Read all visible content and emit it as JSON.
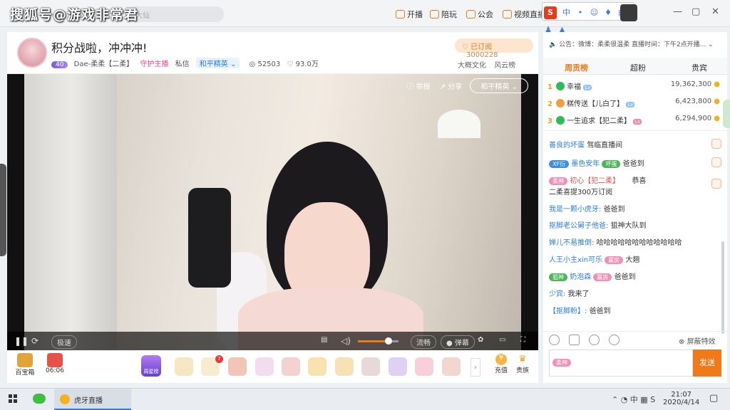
{
  "app": {
    "taskbar_label": "虎牙直播"
  },
  "watermark": "搜狐号@游戏非常君",
  "search": {
    "placeholder": "大仙"
  },
  "topnav": [
    {
      "label": "开播"
    },
    {
      "label": "陪玩"
    },
    {
      "label": "公会"
    },
    {
      "label": "视频直播"
    }
  ],
  "room": {
    "title": "积分战啦，冲冲冲!",
    "level": "40",
    "streamer": "Dae-柔柔【二柔】",
    "guard_tag": "守护主播",
    "message_link": "私信",
    "category": "和平精英",
    "viewers": "52503",
    "fans_count": "93.0万",
    "subscribe_label": "已订阅",
    "subscribe_count": "3000228",
    "links": [
      "大概文化",
      "风云榜"
    ]
  },
  "video": {
    "report": "举报",
    "share": "分享",
    "quality_top": "和平精英",
    "speed": "极速",
    "quality_bottom": "流畅",
    "danmu": "弹幕",
    "volume_level": 0.75
  },
  "gifts": {
    "treasure_label": "百宝箱",
    "timer_label": "06:06",
    "recharge_label": "充值",
    "noble_label": "贵族",
    "weekly_star": "周星榜",
    "badge_count": "7"
  },
  "panel": {
    "notice": "公告：微博：柔柔很温柔  直播时间：下午2点开播...",
    "tabs": [
      "周贡榜",
      "超粉",
      "贵宾"
    ],
    "ranking": [
      {
        "rank": "1",
        "name": "幸福",
        "lv": "Lv",
        "value": "19,362,300"
      },
      {
        "rank": "2",
        "name": "糕传送【儿白了】",
        "lv": "Lv",
        "value": "6,423,800"
      },
      {
        "rank": "3",
        "name": "一生追求【犯二柔】",
        "lv": "Lv",
        "value": "6,294,900"
      }
    ],
    "chat": [
      {
        "user": "善良的坏蛋",
        "text": "驾临直播间"
      },
      {
        "badge": "XF衍",
        "user": "墨色安年",
        "fan": "坏蛋",
        "text": "爸爸到"
      },
      {
        "fan": "柔神",
        "user": "初心【犯二柔】",
        "text": "恭喜"
      },
      {
        "text": "二柔喜提300万订阅"
      },
      {
        "user": "我是一颗小虎牙:",
        "text": "爸爸到"
      },
      {
        "user": "抠脚老公舅子他爸:",
        "text": "狙神大队到"
      },
      {
        "user": "婵儿不易推倒:",
        "text": "哈哈哈哈哈哈哈哈哈哈哈哈"
      },
      {
        "user": "人王小主xin可乐",
        "fan": "赢房",
        "text": "大翘"
      },
      {
        "badge": "狙神",
        "user": "奶泡森",
        "fan": "赢房",
        "text": "爸爸到"
      },
      {
        "user": "少宾:",
        "text": "我来了"
      },
      {
        "user": "【抠脚粉】:",
        "text": "爸爸到"
      }
    ],
    "shield_label": "屏蔽特效",
    "input_badge": "柔神",
    "send_label": "发送"
  },
  "taskbar": {
    "time": "21:07",
    "date": "2020/4/14"
  },
  "colors": {
    "accent": "#f07a1a",
    "link": "#2f7ddd",
    "fan": "#f090b6"
  }
}
